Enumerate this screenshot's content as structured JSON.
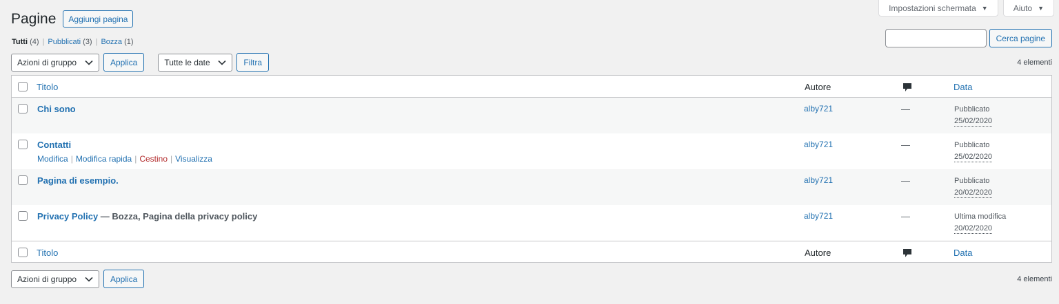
{
  "screen_tabs": {
    "screen_options": "Impostazioni schermata",
    "help": "Aiuto"
  },
  "header": {
    "title": "Pagine",
    "add_button": "Aggiungi pagina"
  },
  "filters": {
    "all": {
      "label": "Tutti",
      "count": "(4)"
    },
    "published": {
      "label": "Pubblicati",
      "count": "(3)"
    },
    "draft": {
      "label": "Bozza",
      "count": "(1)"
    },
    "separator": "|"
  },
  "search": {
    "value": "",
    "button": "Cerca pagine"
  },
  "tablenav_top": {
    "bulk_action": "Azioni di gruppo",
    "apply": "Applica",
    "date_filter": "Tutte le date",
    "filter": "Filtra",
    "count": "4 elementi"
  },
  "tablenav_bottom": {
    "bulk_action": "Azioni di gruppo",
    "apply": "Applica",
    "count": "4 elementi"
  },
  "columns": {
    "title": "Titolo",
    "author": "Autore",
    "comments_icon": "comment-bubble-icon",
    "date": "Data"
  },
  "rows": [
    {
      "title": "Chi sono",
      "state": "",
      "author": "alby721",
      "comments": "—",
      "status": "Pubblicato",
      "date": "25/02/2020"
    },
    {
      "title": "Contatti",
      "state": "",
      "author": "alby721",
      "comments": "—",
      "status": "Pubblicato",
      "date": "25/02/2020",
      "actions": {
        "edit": "Modifica",
        "quick_edit": "Modifica rapida",
        "trash": "Cestino",
        "view": "Visualizza"
      }
    },
    {
      "title": "Pagina di esempio.",
      "state": "",
      "author": "alby721",
      "comments": "—",
      "status": "Pubblicato",
      "date": "20/02/2020"
    },
    {
      "title": "Privacy Policy",
      "state": " — Bozza, Pagina della privacy policy",
      "author": "alby721",
      "comments": "—",
      "status": "Ultima modifica",
      "date": "20/02/2020"
    }
  ],
  "colors": {
    "link": "#2271b1",
    "trash": "#b32d2e",
    "background": "#f1f1f1"
  }
}
